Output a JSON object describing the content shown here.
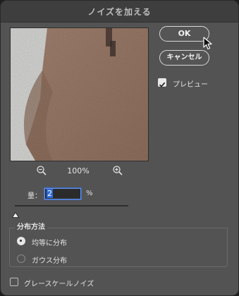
{
  "dialog": {
    "title": "ノイズを加える"
  },
  "buttons": {
    "ok_label": "OK",
    "cancel_label": "キャンセル"
  },
  "preview_toggle": {
    "label": "プレビュー",
    "checked": true
  },
  "zoom": {
    "level": "100%",
    "zoom_out_icon": "zoom-out-icon",
    "zoom_in_icon": "zoom-in-icon"
  },
  "amount": {
    "label": "量：",
    "value": "2",
    "unit": "%",
    "slider_value_fraction": 0.005
  },
  "distribution": {
    "group_label": "分布方法",
    "options": [
      {
        "label": "均等に分布",
        "selected": true
      },
      {
        "label": "ガウス分布",
        "selected": false
      }
    ]
  },
  "monochrome": {
    "label": "グレースケールノイズ",
    "checked": false
  },
  "colors": {
    "dialog_bg": "#535353",
    "titlebar_bg": "#3e3e3e",
    "preview_subject": "#9b7a68",
    "preview_wall": "#d6d6d4",
    "focus_blue": "#2f6bd8"
  }
}
